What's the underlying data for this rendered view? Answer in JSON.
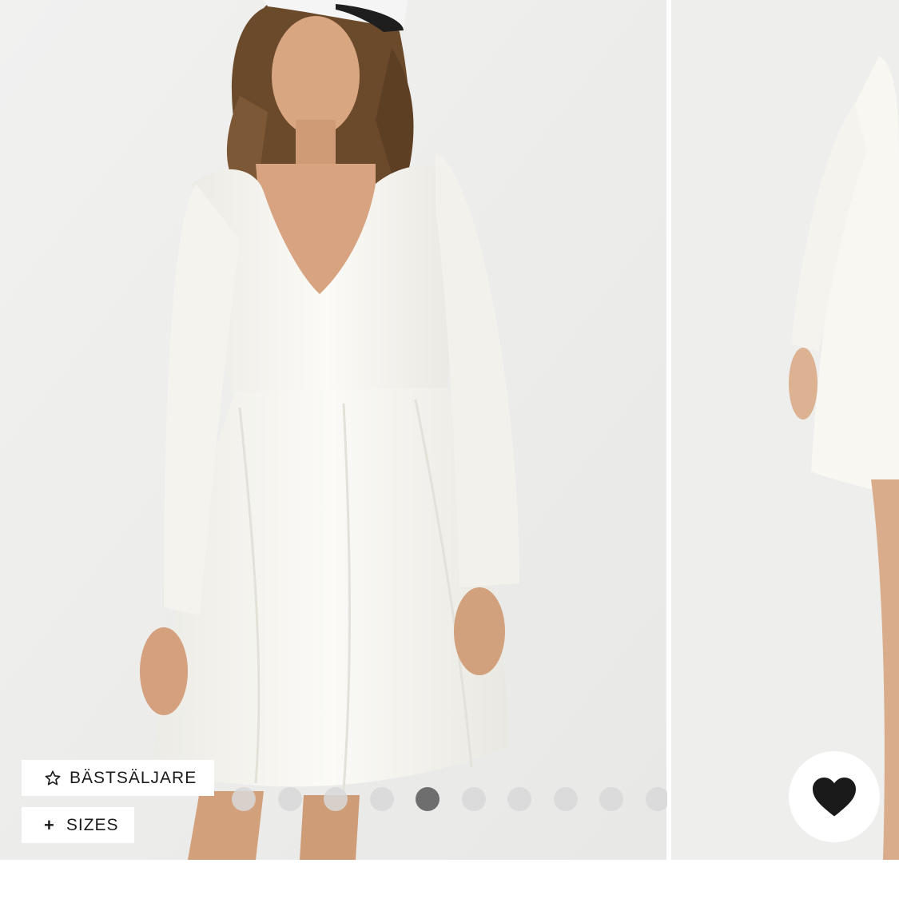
{
  "gallery": {
    "badges": {
      "bestseller_label": "BÄSTSÄLJARE",
      "bestseller_icon": "star-outline-icon",
      "sizes_label": "SIZES",
      "sizes_icon": "plus-icon"
    },
    "pagination": {
      "dot_count": 10,
      "active_index": 4
    },
    "favorite": {
      "icon": "heart-icon",
      "state": "filled"
    }
  },
  "colors": {
    "background": "#eeeeee",
    "dress": "#f6f5f0",
    "active_dot": "#6e6e6e",
    "inactive_dot": "#d8d8d8",
    "heart": "#1a1a1a"
  }
}
